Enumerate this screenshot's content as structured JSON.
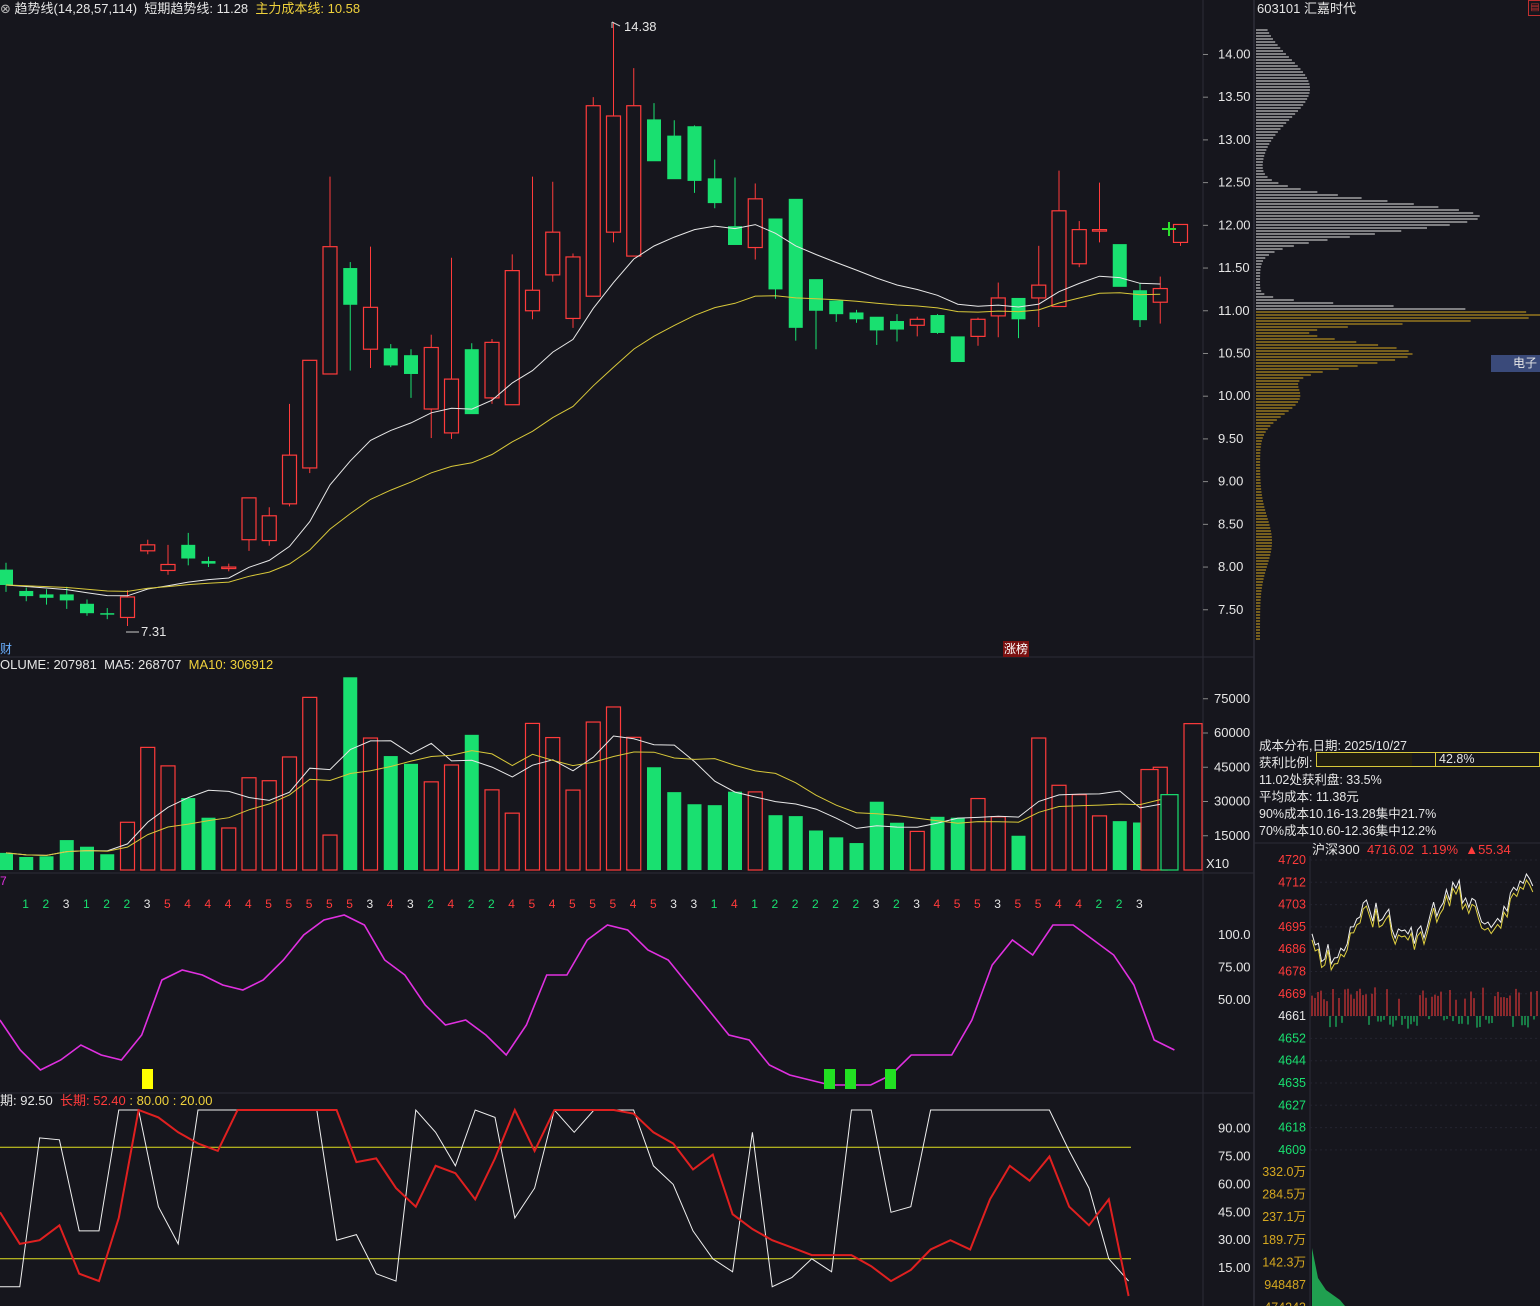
{
  "main_chart": {
    "legend": {
      "trend": "趋势线(14,28,57,114)",
      "short_trend": "短期趋势线: 11.28",
      "main_cost": "主力成本线: 10.58"
    },
    "high_label": "14.38",
    "low_label": "7.31",
    "bottom_left_tag": "财",
    "bottom_tag": "涨榜",
    "y_ticks": [
      "14.00",
      "13.50",
      "13.00",
      "12.50",
      "12.00",
      "11.50",
      "11.00",
      "10.50",
      "10.00",
      "9.50",
      "9.00",
      "8.50",
      "8.00",
      "7.50"
    ]
  },
  "volume_panel": {
    "legend": {
      "volume": "OLUME: 207981",
      "ma5": "MA5: 268707",
      "ma10": "MA10: 306912"
    },
    "unit": "X10",
    "y_ticks": [
      "75000",
      "60000",
      "45000",
      "30000",
      "15000"
    ]
  },
  "indicator_panel": {
    "left_tag": "7",
    "counts": [
      "1",
      "2",
      "3",
      "1",
      "2",
      "2",
      "3",
      "5",
      "4",
      "4",
      "4",
      "4",
      "5",
      "5",
      "5",
      "5",
      "5",
      "3",
      "4",
      "3",
      "2",
      "4",
      "2",
      "2",
      "4",
      "5",
      "4",
      "5",
      "5",
      "5",
      "4",
      "5",
      "3",
      "3",
      "1",
      "4",
      "1",
      "2",
      "2",
      "2",
      "2",
      "2",
      "3",
      "2",
      "3",
      "4",
      "5",
      "5",
      "3",
      "5",
      "5",
      "4",
      "4",
      "2",
      "2",
      "3"
    ],
    "y_ticks": [
      "100.0",
      "75.00",
      "50.00"
    ]
  },
  "kd_panel": {
    "legend": {
      "short": "期: 92.50",
      "long": "长期: 52.40",
      "levels": ": 80.00 : 20.00"
    },
    "y_ticks": [
      "90.00",
      "75.00",
      "60.00",
      "45.00",
      "30.00",
      "15.00"
    ]
  },
  "chip_panel": {
    "stock": "603101 汇嘉时代",
    "tag": "电子",
    "title": "成本分布,日期: 2025/10/27",
    "profit_label": "获利比例:",
    "profit_value": "42.8%",
    "profit_ratio": 0.428,
    "line_profit": "11.02处获利盘: 33.5%",
    "avg_cost": "平均成本: 11.38元",
    "c90": "90%成本10.16-13.28集中21.7%",
    "c70": "70%成本10.60-12.36集中12.2%"
  },
  "index_panel": {
    "name": "沪深300",
    "price": "4716.02",
    "pct": "1.19%",
    "change": "▲55.34",
    "price_ticks": [
      "4720",
      "4712",
      "4703",
      "4695",
      "4686",
      "4678",
      "4669",
      "4661",
      "4652",
      "4644",
      "4635",
      "4627",
      "4618",
      "4609"
    ],
    "vol_ticks": [
      "332.0万",
      "284.5万",
      "237.1万",
      "189.7万",
      "142.3万",
      "948487",
      "474243"
    ]
  },
  "colors": {
    "bg": "#16161d",
    "up": "#ff3b3b",
    "down": "#19e070",
    "ma_white": "#e8e8e8",
    "ma_yellow": "#d8c83a",
    "magenta": "#e030e0"
  },
  "chart_data": [
    {
      "type": "candlestick",
      "title": "",
      "x": [
        "1",
        "2",
        "3",
        "4",
        "5",
        "6",
        "7",
        "8",
        "9",
        "10",
        "11",
        "12",
        "13",
        "14",
        "15",
        "16",
        "17",
        "18",
        "19",
        "20",
        "21",
        "22",
        "23",
        "24",
        "25",
        "26",
        "27",
        "28",
        "29",
        "30",
        "31",
        "32",
        "33",
        "34",
        "35",
        "36",
        "37",
        "38",
        "39",
        "40",
        "41",
        "42",
        "43",
        "44",
        "45",
        "46",
        "47",
        "48",
        "49",
        "50",
        "51",
        "52",
        "53",
        "54",
        "55",
        "56",
        "57",
        "58",
        "59"
      ],
      "open": [
        7.97,
        7.72,
        7.68,
        7.68,
        7.57,
        7.46,
        7.41,
        8.19,
        7.96,
        8.26,
        8.07,
        7.99,
        8.32,
        8.31,
        8.74,
        9.16,
        10.26,
        11.5,
        10.55,
        10.56,
        10.48,
        9.85,
        9.57,
        10.55,
        9.98,
        9.9,
        11.0,
        11.42,
        10.91,
        11.17,
        11.92,
        11.64,
        13.24,
        13.05,
        13.16,
        12.55,
        11.99,
        11.74,
        12.08,
        12.31,
        11.37,
        11.12,
        10.98,
        10.93,
        10.88,
        10.83,
        10.95,
        10.7,
        10.7,
        10.94,
        11.15,
        11.15,
        11.05,
        11.55,
        11.95,
        11.78,
        11.24,
        11.1,
        11.8
      ],
      "close": [
        7.79,
        7.66,
        7.64,
        7.61,
        7.46,
        7.45,
        7.65,
        8.26,
        8.03,
        8.1,
        8.04,
        8.0,
        8.81,
        8.6,
        9.31,
        10.42,
        11.75,
        11.07,
        11.04,
        10.36,
        10.26,
        10.57,
        10.2,
        9.79,
        10.63,
        11.47,
        11.24,
        11.92,
        11.63,
        13.4,
        13.28,
        13.4,
        12.75,
        12.54,
        12.52,
        12.26,
        11.77,
        12.31,
        11.25,
        10.8,
        11.0,
        10.96,
        10.9,
        10.77,
        10.78,
        10.9,
        10.74,
        10.4,
        10.9,
        11.15,
        10.9,
        11.3,
        12.17,
        11.95,
        11.95,
        11.28,
        10.89,
        11.26,
        12.01
      ],
      "high": [
        8.05,
        7.76,
        7.74,
        7.77,
        7.62,
        7.52,
        7.73,
        8.32,
        8.26,
        8.4,
        8.12,
        8.04,
        8.81,
        8.7,
        9.91,
        10.42,
        12.57,
        11.57,
        11.75,
        10.61,
        10.55,
        10.72,
        11.62,
        10.62,
        10.67,
        11.66,
        12.57,
        12.51,
        11.67,
        13.5,
        14.38,
        13.84,
        13.43,
        13.23,
        13.17,
        12.77,
        12.56,
        12.49,
        11.66,
        11.33,
        11.14,
        11.06,
        11.01,
        10.85,
        10.96,
        10.93,
        10.96,
        10.67,
        10.92,
        11.33,
        11.12,
        11.76,
        12.64,
        12.05,
        12.5,
        11.35,
        11.32,
        11.4,
        12.01
      ],
      "low": [
        7.71,
        7.6,
        7.56,
        7.51,
        7.43,
        7.39,
        7.31,
        8.15,
        7.91,
        8.02,
        8.0,
        7.95,
        8.19,
        8.25,
        8.71,
        9.1,
        10.31,
        10.3,
        10.33,
        10.34,
        9.98,
        9.51,
        9.5,
        9.89,
        9.91,
        9.93,
        10.9,
        11.34,
        10.8,
        11.19,
        11.8,
        12.97,
        12.98,
        12.78,
        12.38,
        12.2,
        11.84,
        11.6,
        11.14,
        10.65,
        10.55,
        10.87,
        10.86,
        10.6,
        10.64,
        10.7,
        10.73,
        10.43,
        10.59,
        10.69,
        10.68,
        10.81,
        11.73,
        11.51,
        11.8,
        11.29,
        10.81,
        10.85,
        11.76
      ],
      "ylabel": "",
      "ylim": [
        7.13,
        14.5
      ]
    },
    {
      "type": "bar",
      "title": "Volume (X10)",
      "x": [
        "1",
        "2",
        "3",
        "4",
        "5",
        "6",
        "7",
        "8",
        "9",
        "10",
        "11",
        "12",
        "13",
        "14",
        "15",
        "16",
        "17",
        "18",
        "19",
        "20",
        "21",
        "22",
        "23",
        "24",
        "25",
        "26",
        "27",
        "28",
        "29",
        "30",
        "31",
        "32",
        "33",
        "34",
        "35",
        "36",
        "37",
        "38",
        "39",
        "40",
        "41",
        "42",
        "43",
        "44",
        "45",
        "46",
        "47",
        "48",
        "49",
        "50",
        "51",
        "52",
        "53",
        "54",
        "55",
        "56",
        "57",
        "58",
        "59"
      ],
      "values": [
        7500,
        5700,
        6000,
        13100,
        10200,
        6900,
        20900,
        53700,
        45600,
        31500,
        22900,
        18400,
        40400,
        39100,
        49500,
        75600,
        15300,
        84400,
        57800,
        49900,
        46500,
        38600,
        46000,
        59200,
        35100,
        24900,
        64200,
        58000,
        35000,
        64800,
        71400,
        58100,
        45000,
        34100,
        28800,
        28400,
        34300,
        34200,
        24000,
        23600,
        17300,
        14300,
        11800,
        29900,
        20700,
        16900,
        23300,
        22900,
        31300,
        23300,
        15000,
        57800,
        37100,
        33000,
        23700,
        21400,
        20800,
        45000,
        64100
      ],
      "ylabel": "",
      "ylim": [
        0,
        83000
      ]
    }
  ]
}
